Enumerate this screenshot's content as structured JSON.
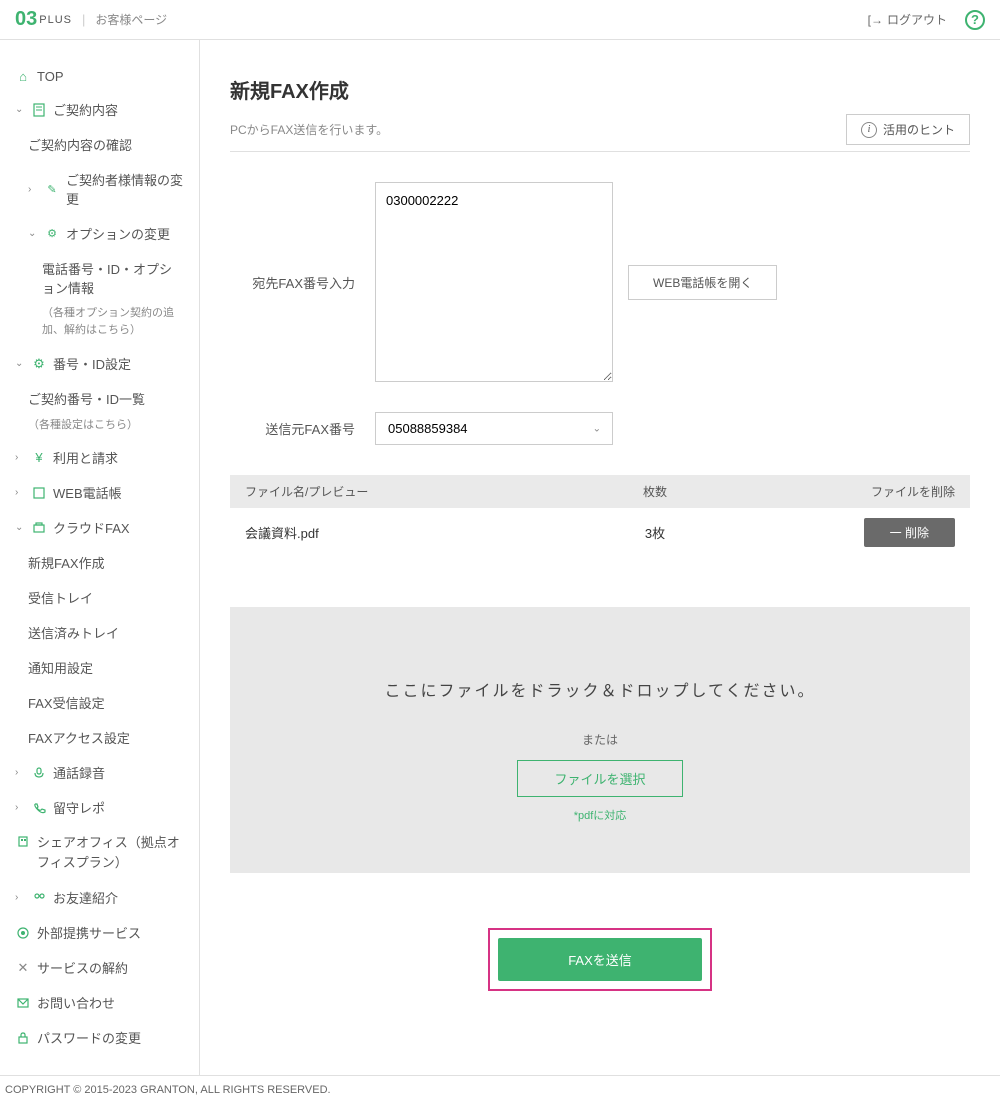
{
  "header": {
    "page_label": "お客様ページ",
    "logout": "ログアウト"
  },
  "sidebar": {
    "top": "TOP",
    "contract": "ご契約内容",
    "contract_confirm": "ご契約内容の確認",
    "contractor_change": "ご契約者様情報の変更",
    "option_change": "オプションの変更",
    "phone_option": "電話番号・ID・オプション情報",
    "phone_option_note": "（各種オプション契約の追加、解約はこちら）",
    "number_id": "番号・ID設定",
    "number_list": "ご契約番号・ID一覧",
    "number_list_note": "（各種設定はこちら）",
    "usage_billing": "利用と請求",
    "web_phonebook": "WEB電話帳",
    "cloud_fax": "クラウドFAX",
    "new_fax": "新規FAX作成",
    "inbox": "受信トレイ",
    "sent": "送信済みトレイ",
    "notification": "通知用設定",
    "fax_receive": "FAX受信設定",
    "fax_access": "FAXアクセス設定",
    "recording": "通話録音",
    "voicemail": "留守レポ",
    "share_office": "シェアオフィス（拠点オフィスプラン）",
    "referral": "お友達紹介",
    "external": "外部提携サービス",
    "cancel": "サービスの解約",
    "inquiry": "お問い合わせ",
    "password": "パスワードの変更"
  },
  "main": {
    "title": "新規FAX作成",
    "subtitle": "PCからFAX送信を行います。",
    "hint_label": "活用のヒント",
    "dest_label": "宛先FAX番号入力",
    "dest_value": "0300002222",
    "phonebook_btn": "WEB電話帳を開く",
    "sender_label": "送信元FAX番号",
    "sender_value": "05088859384",
    "table": {
      "header_name": "ファイル名/プレビュー",
      "header_pages": "枚数",
      "header_delete": "ファイルを削除",
      "file_name": "会議資料.pdf",
      "file_pages": "3枚",
      "delete_btn": "一 削除"
    },
    "drop": {
      "text": "ここにファイルをドラック＆ドロップしてください。",
      "or": "または",
      "select_btn": "ファイルを選択",
      "note": "*pdfに対応"
    },
    "send_btn": "FAXを送信"
  },
  "footer": {
    "copyright": "COPYRIGHT © 2015-2023 GRANTON, ALL RIGHTS RESERVED."
  }
}
